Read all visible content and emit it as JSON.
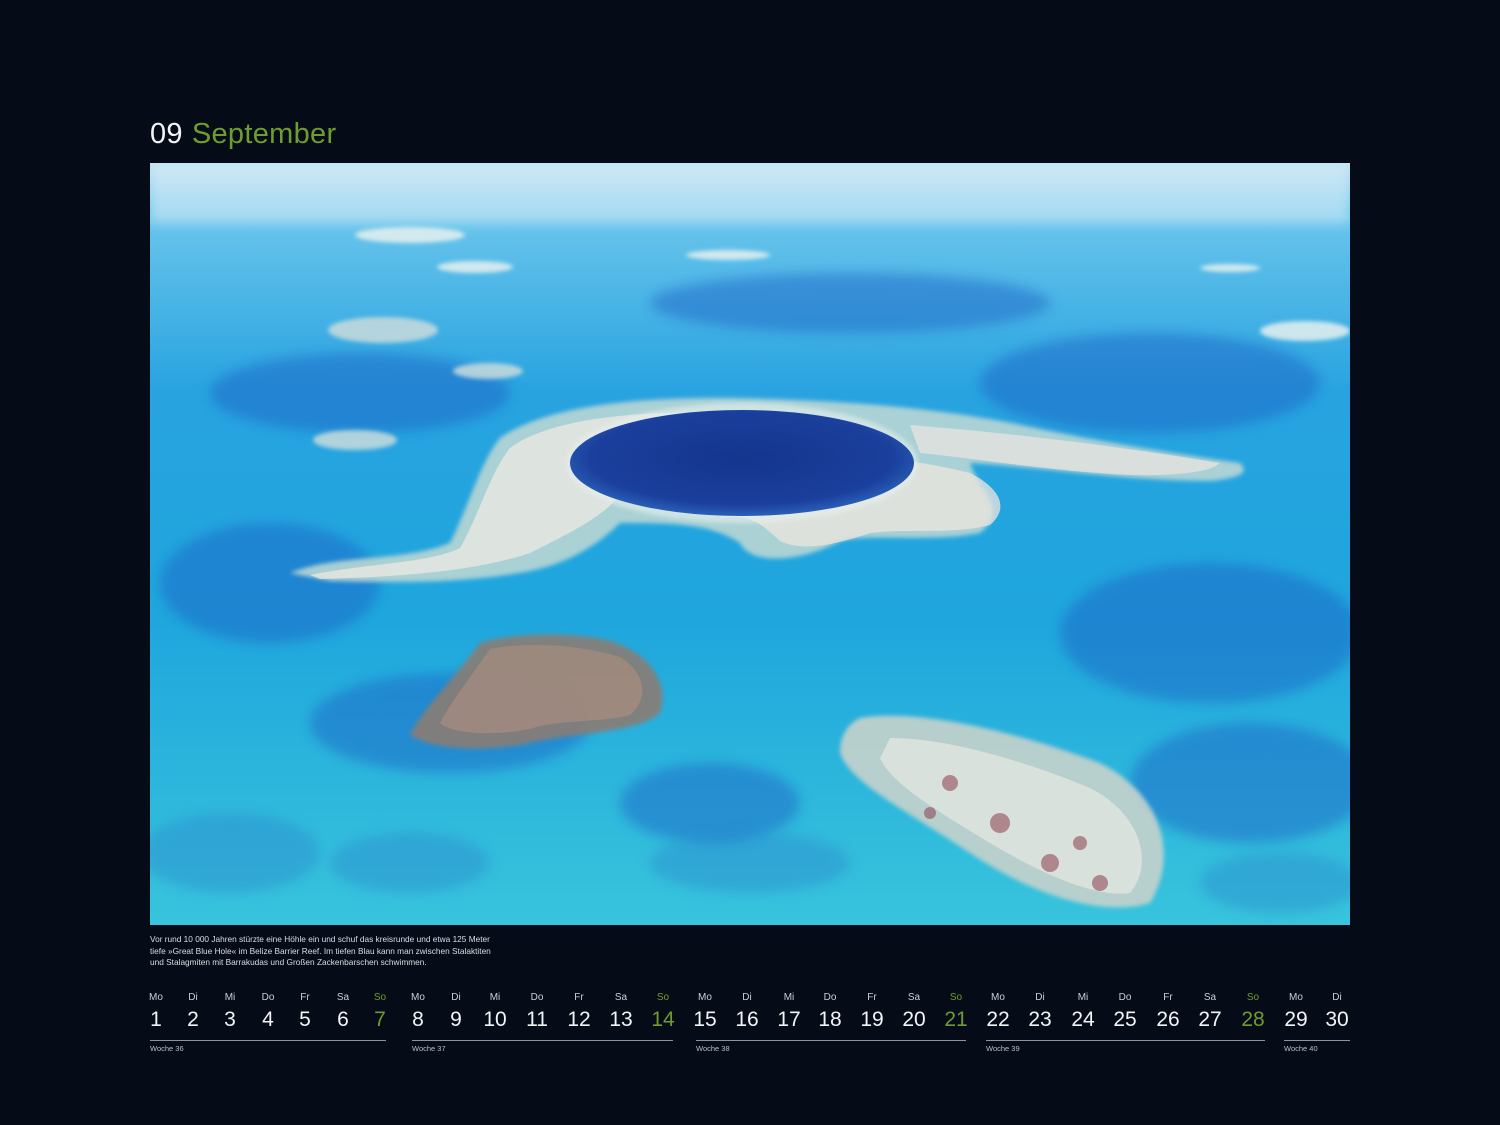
{
  "header": {
    "month_number": "09",
    "month_name": "September"
  },
  "photo": {
    "alt": "Great Blue Hole, Belize Barrier Reef"
  },
  "caption": {
    "lines": [
      "Vor rund 10 000 Jahren stürzte eine Höhle ein und schuf das kreisrunde und etwa 125 Meter",
      "tiefe »Great Blue Hole« im Belize Barrier Reef. Im tiefen Blau kann man zwischen Stalaktiten",
      "und Stalagmiten mit Barrakudas und Großen Zackenbarschen schwimmen."
    ]
  },
  "weeks": [
    {
      "label": "Woche 36",
      "days": [
        {
          "wd": "Mo",
          "n": "1"
        },
        {
          "wd": "Di",
          "n": "2"
        },
        {
          "wd": "Mi",
          "n": "3"
        },
        {
          "wd": "Do",
          "n": "4"
        },
        {
          "wd": "Fr",
          "n": "5"
        },
        {
          "wd": "Sa",
          "n": "6"
        },
        {
          "wd": "So",
          "n": "7"
        }
      ]
    },
    {
      "label": "Woche 37",
      "days": [
        {
          "wd": "Mo",
          "n": "8"
        },
        {
          "wd": "Di",
          "n": "9"
        },
        {
          "wd": "Mi",
          "n": "10"
        },
        {
          "wd": "Do",
          "n": "11"
        },
        {
          "wd": "Fr",
          "n": "12"
        },
        {
          "wd": "Sa",
          "n": "13"
        },
        {
          "wd": "So",
          "n": "14"
        }
      ]
    },
    {
      "label": "Woche 38",
      "days": [
        {
          "wd": "Mo",
          "n": "15"
        },
        {
          "wd": "Di",
          "n": "16"
        },
        {
          "wd": "Mi",
          "n": "17"
        },
        {
          "wd": "Do",
          "n": "18"
        },
        {
          "wd": "Fr",
          "n": "19"
        },
        {
          "wd": "Sa",
          "n": "20"
        },
        {
          "wd": "So",
          "n": "21"
        }
      ]
    },
    {
      "label": "Woche 39",
      "days": [
        {
          "wd": "Mo",
          "n": "22"
        },
        {
          "wd": "Di",
          "n": "23"
        },
        {
          "wd": "Mi",
          "n": "24"
        },
        {
          "wd": "Do",
          "n": "25"
        },
        {
          "wd": "Fr",
          "n": "26"
        },
        {
          "wd": "Sa",
          "n": "27"
        },
        {
          "wd": "So",
          "n": "28"
        }
      ]
    },
    {
      "label": "Woche 40",
      "days": [
        {
          "wd": "Mo",
          "n": "29"
        },
        {
          "wd": "Di",
          "n": "30"
        }
      ]
    }
  ],
  "colors": {
    "background": "#050c17",
    "accent_green": "#6f9c2f",
    "text": "#f2f4f5"
  }
}
